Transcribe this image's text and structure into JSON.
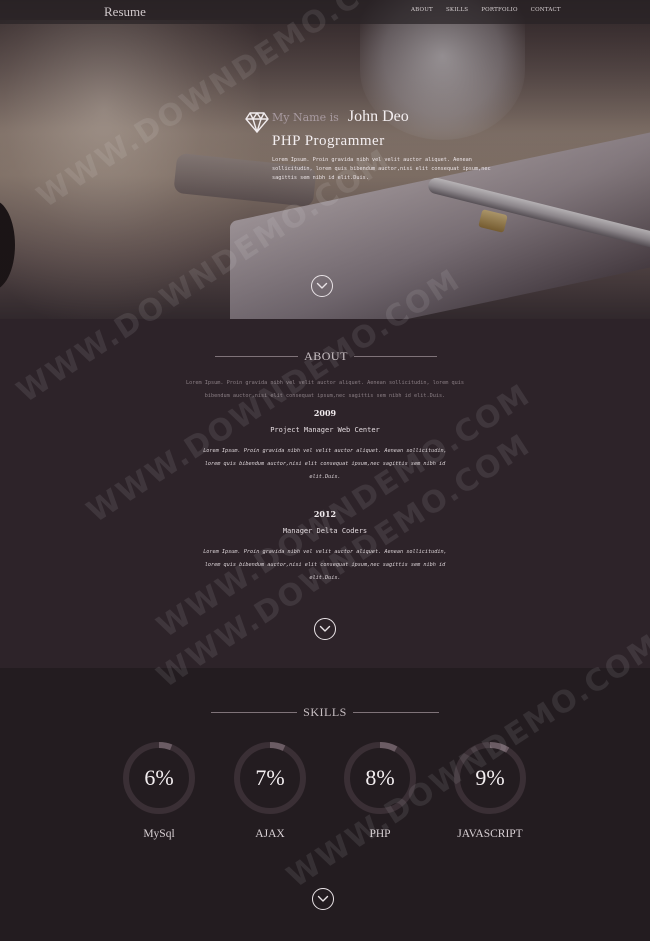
{
  "navbar": {
    "brand": "Resume",
    "links": [
      "ABOUT",
      "SKILLS",
      "PORTFOLIO",
      "CONTACT"
    ]
  },
  "hero": {
    "icon": "diamond-icon",
    "name_prefix": "My Name is",
    "name": "John Deo",
    "title": "PHP Programmer",
    "description": "Lorem Ipsum. Proin gravida nibh vel velit auctor aliquet. Aenean sollicitudin, lorem quis bibendum auctor,nisi elit consequat ipsum,nec sagittis sem nibh id elit.Duis."
  },
  "about": {
    "heading": "ABOUT",
    "intro": "Lorem Ipsum. Proin gravida nibh vel velit auctor aliquet. Aenean sollicitudin, lorem quis bibendum auctor,nisi elit consequat ipsum,nec sagittis sem nibh id elit.Duis.",
    "timeline": [
      {
        "year": "2009",
        "role": "Project Manager Web Center",
        "description": "Lorem Ipsum. Proin gravida nibh vel velit auctor aliquet. Aenean sollicitudin, lorem quis bibendum auctor,nisi elit consequat ipsum,nec sagittis sem nibh id elit.Duis."
      },
      {
        "year": "2012",
        "role": "Manager Delta Coders",
        "description": "Lorem Ipsum. Proin gravida nibh vel velit auctor aliquet. Aenean sollicitudin, lorem quis bibendum auctor,nisi elit consequat ipsum,nec sagittis sem nibh id elit.Duis."
      }
    ]
  },
  "skills": {
    "heading": "SKILLS",
    "items": [
      {
        "label": "MySql",
        "value_text": "6%",
        "percent": 6
      },
      {
        "label": "AJAX",
        "value_text": "7%",
        "percent": 7
      },
      {
        "label": "PHP",
        "value_text": "8%",
        "percent": 8
      },
      {
        "label": "JAVASCRIPT",
        "value_text": "9%",
        "percent": 9
      }
    ]
  },
  "scroll_icon": "chevron-down-icon",
  "watermark": "WWW.DOWNDEMO.COM",
  "colors": {
    "hero_text": "#f3eef0",
    "about_bg": "#2d2329",
    "skills_bg": "#231c20",
    "ring_track": "#3a2f35",
    "ring_fill": "#6b5c64"
  }
}
